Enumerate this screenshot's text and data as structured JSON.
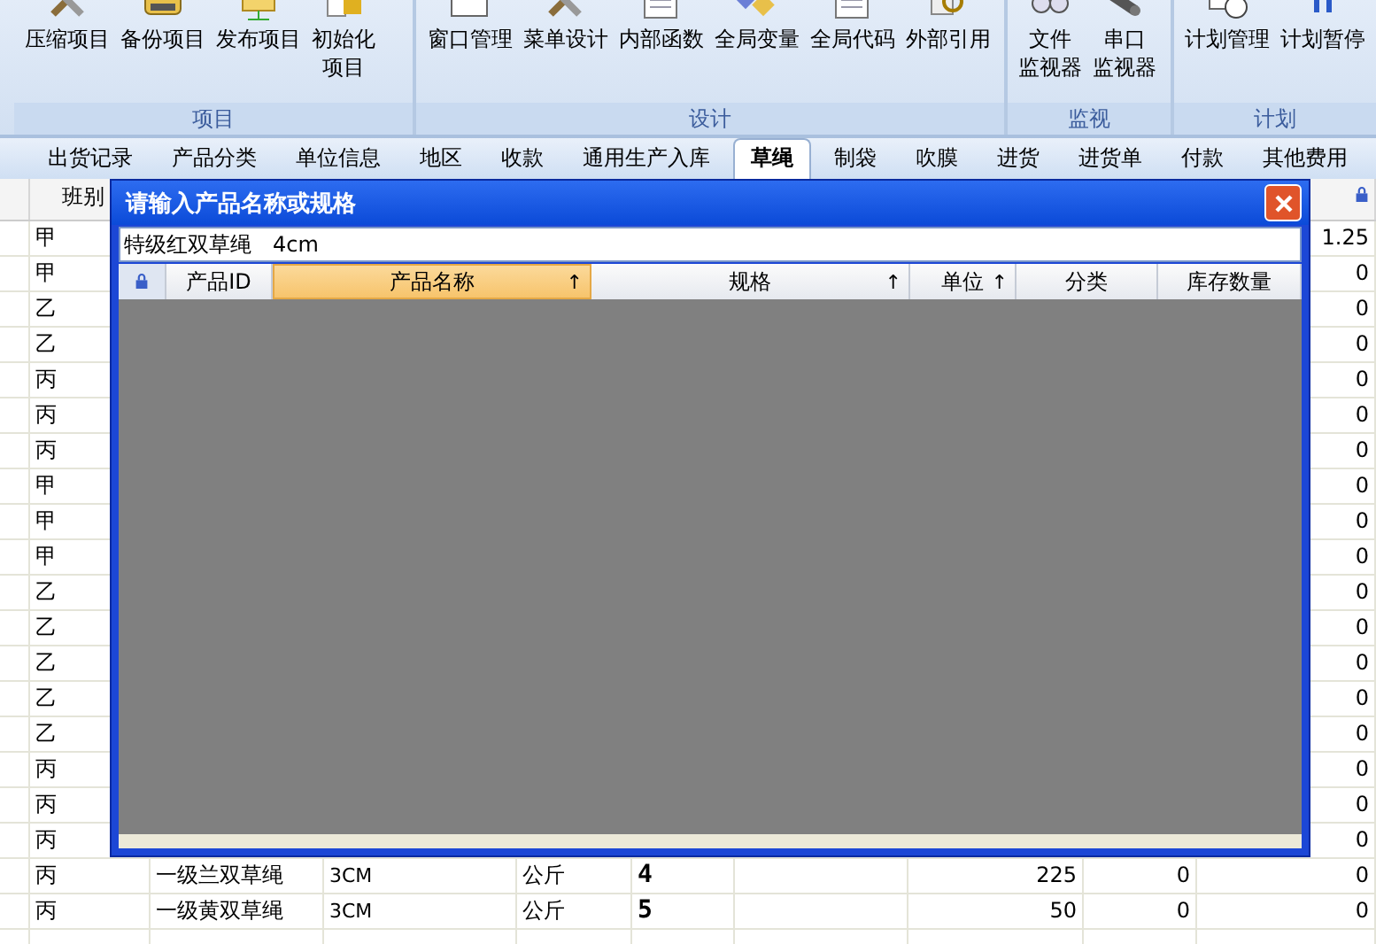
{
  "ribbon": {
    "groups": [
      {
        "label": "项目",
        "buttons": [
          {
            "lines": [
              "压缩项目"
            ]
          },
          {
            "lines": [
              "备份项目"
            ]
          },
          {
            "lines": [
              "发布项目"
            ]
          },
          {
            "lines": [
              "初始化",
              "项目"
            ]
          }
        ]
      },
      {
        "label": "设计",
        "buttons": [
          {
            "lines": [
              "窗口管理"
            ]
          },
          {
            "lines": [
              "菜单设计"
            ]
          },
          {
            "lines": [
              "内部函数"
            ]
          },
          {
            "lines": [
              "全局变量"
            ]
          },
          {
            "lines": [
              "全局代码"
            ]
          },
          {
            "lines": [
              "外部引用"
            ]
          }
        ]
      },
      {
        "label": "监视",
        "buttons": [
          {
            "lines": [
              "文件",
              "监视器"
            ]
          },
          {
            "lines": [
              "串口",
              "监视器"
            ]
          }
        ]
      },
      {
        "label": "计划",
        "buttons": [
          {
            "lines": [
              "计划管理"
            ]
          },
          {
            "lines": [
              "计划暂停"
            ]
          }
        ]
      }
    ]
  },
  "tabs": [
    {
      "label": "出货记录",
      "selected": false
    },
    {
      "label": "产品分类",
      "selected": false
    },
    {
      "label": "单位信息",
      "selected": false
    },
    {
      "label": "地区",
      "selected": false
    },
    {
      "label": "收款",
      "selected": false
    },
    {
      "label": "通用生产入库",
      "selected": false
    },
    {
      "label": "草绳",
      "selected": true
    },
    {
      "label": "制袋",
      "selected": false
    },
    {
      "label": "吹膜",
      "selected": false
    },
    {
      "label": "进货",
      "selected": false
    },
    {
      "label": "进货单",
      "selected": false
    },
    {
      "label": "付款",
      "selected": false
    },
    {
      "label": "其他费用",
      "selected": false
    }
  ],
  "table": {
    "columns": [
      {
        "label": "班别"
      }
    ],
    "header_lock": true,
    "rows": [
      {
        "column_1": "甲",
        "column_9": "1.25"
      },
      {
        "column_1": "甲",
        "column_9": "0"
      },
      {
        "column_1": "乙",
        "column_9": "0"
      },
      {
        "column_1": "乙",
        "column_9": "0"
      },
      {
        "column_1": "丙",
        "column_9": "0"
      },
      {
        "column_1": "丙",
        "column_9": "0"
      },
      {
        "column_1": "丙",
        "column_9": "0"
      },
      {
        "column_1": "甲",
        "column_9": "0"
      },
      {
        "column_1": "甲",
        "column_9": "0"
      },
      {
        "column_1": "甲",
        "column_9": "0"
      },
      {
        "column_1": "乙",
        "column_9": "0"
      },
      {
        "column_1": "乙",
        "column_9": "0"
      },
      {
        "column_1": "乙",
        "column_9": "0"
      },
      {
        "column_1": "乙",
        "column_9": "0"
      },
      {
        "column_1": "乙",
        "column_9": "0"
      },
      {
        "column_1": "丙",
        "column_9": "0"
      },
      {
        "column_1": "丙",
        "column_9": "0"
      },
      {
        "column_1": "丙",
        "column_9": "0"
      },
      {
        "column_1": "丙",
        "column_2": "一级兰双草绳",
        "column_3": "3CM",
        "column_4": "公斤",
        "column_5": "4",
        "column_7": "225",
        "column_8": "0",
        "column_9": "0"
      },
      {
        "column_1": "丙",
        "column_2": "一级黄双草绳",
        "column_3": "3CM",
        "column_4": "公斤",
        "column_5": "5",
        "column_7": "50",
        "column_8": "0",
        "column_9": "0"
      }
    ]
  },
  "dialog": {
    "title": "请输入产品名称或规格",
    "search": {
      "value": "特级红双草绳　4cm"
    },
    "columns": [
      {
        "label": "产品ID",
        "selected": false
      },
      {
        "label": "产品名称",
        "selected": true,
        "sort": "↑"
      },
      {
        "label": "规格",
        "selected": false,
        "sort": "↑"
      },
      {
        "label": "单位",
        "selected": false,
        "sort": "↑"
      },
      {
        "label": "分类",
        "selected": false
      },
      {
        "label": "库存数量",
        "selected": false
      }
    ]
  }
}
